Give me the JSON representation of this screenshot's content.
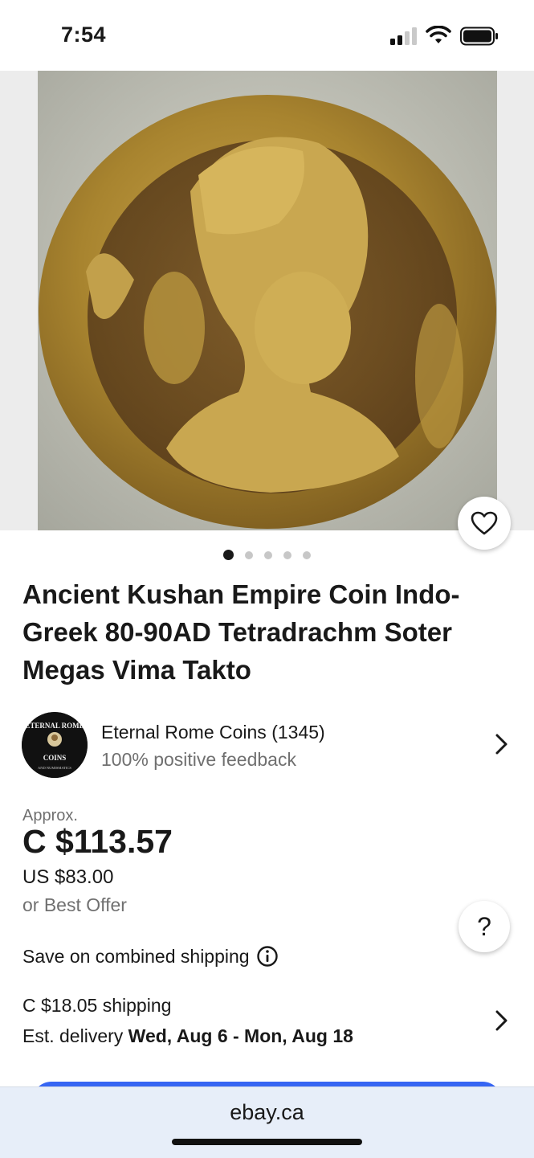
{
  "status_bar": {
    "time": "7:54"
  },
  "product": {
    "image_dots": {
      "count": 5,
      "active_index": 0
    },
    "title": "Ancient Kushan Empire Coin Indo-Greek 80-90AD Tetradrachm Soter Megas Vima Takto"
  },
  "seller": {
    "name_with_count": "Eternal Rome Coins (1345)",
    "feedback": "100% positive feedback",
    "logo_text_top": "ETERNAL ROME",
    "logo_text_mid": "COINS",
    "logo_text_bottom": "AND NUMISMATICS"
  },
  "price": {
    "approx_label": "Approx.",
    "converted": "C $113.57",
    "original": "US $83.00",
    "best_offer": "or Best Offer"
  },
  "help_label": "?",
  "shipping": {
    "combined_label": "Save on combined shipping",
    "cost": "C $18.05 shipping",
    "est_prefix": "Est. delivery ",
    "est_dates": "Wed, Aug 6 - Mon, Aug 18"
  },
  "browser": {
    "url": "ebay.ca"
  },
  "colors": {
    "accent": "#3665f3",
    "text": "#191919",
    "muted": "#707070"
  }
}
